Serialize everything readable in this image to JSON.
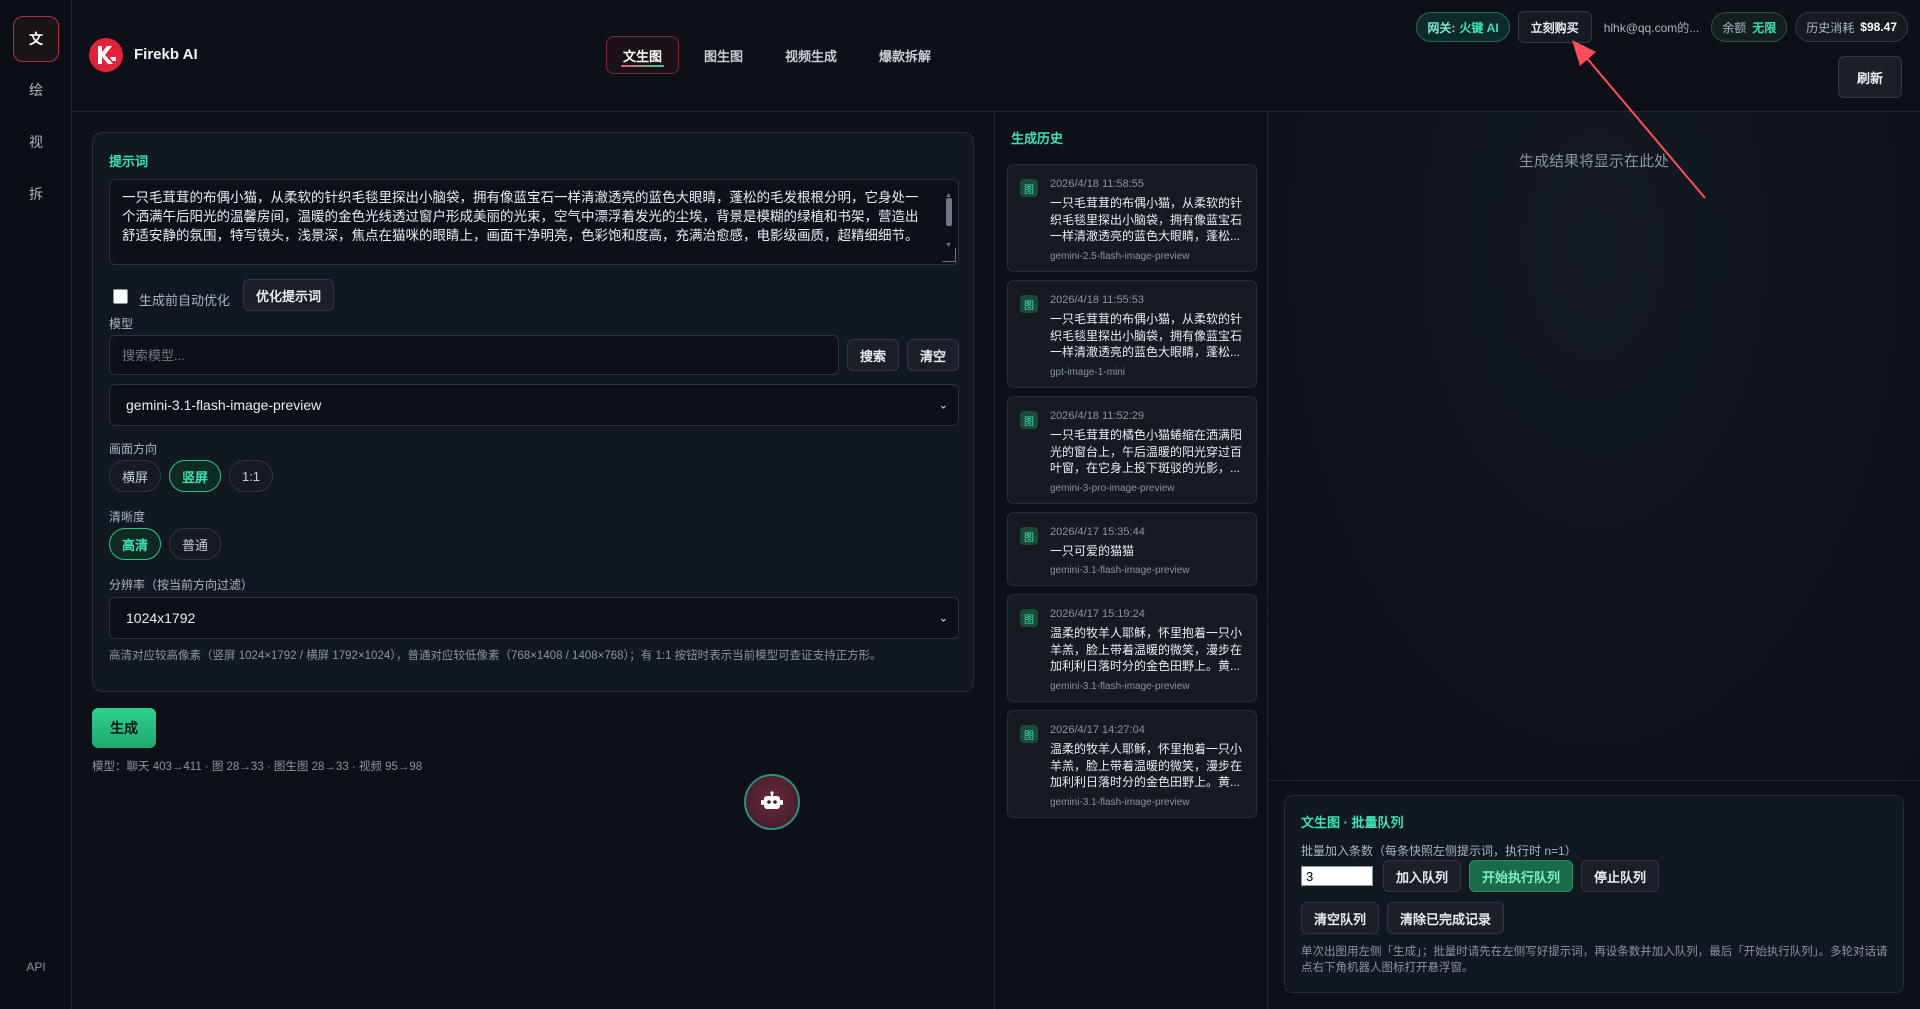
{
  "rail": {
    "items": [
      {
        "label": "文",
        "active": true
      },
      {
        "label": "绘",
        "active": false
      },
      {
        "label": "视",
        "active": false
      },
      {
        "label": "拆",
        "active": false
      }
    ],
    "api": "API"
  },
  "header": {
    "brand": "Firekb AI",
    "tabs": [
      {
        "label": "文生图",
        "active": true
      },
      {
        "label": "图生图",
        "active": false
      },
      {
        "label": "视频生成",
        "active": false
      },
      {
        "label": "爆款拆解",
        "active": false
      }
    ],
    "gateway_label": "网关:",
    "gateway_value": "火键 AI",
    "buy_label": "立刻购买",
    "email": "hlhk@qq.com的...",
    "balance_label": "余额",
    "balance_value": "无限",
    "history_label": "历史消耗",
    "history_value": "$98.47",
    "refresh_label": "刷新"
  },
  "prompt": {
    "section_label": "提示词",
    "text": "一只毛茸茸的布偶小猫，从柔软的针织毛毯里探出小脑袋，拥有像蓝宝石一样清澈透亮的蓝色大眼睛，蓬松的毛发根根分明，它身处一个洒满午后阳光的温馨房间，温暖的金色光线透过窗户形成美丽的光束，空气中漂浮着发光的尘埃，背景是模糊的绿植和书架，营造出舒适安静的氛围，特写镜头，浅景深，焦点在猫咪的眼睛上，画面干净明亮，色彩饱和度高，充满治愈感，电影级画质，超精细细节。",
    "auto_optimize_label": "生成前自动优化",
    "optimize_button": "优化提示词"
  },
  "model": {
    "label": "模型",
    "search_placeholder": "搜索模型...",
    "search_button": "搜索",
    "clear_button": "清空",
    "selected": "gemini-3.1-flash-image-preview"
  },
  "orientation": {
    "label": "画面方向",
    "options": [
      {
        "label": "横屏",
        "active": false
      },
      {
        "label": "竖屏",
        "active": true
      },
      {
        "label": "1:1",
        "active": false
      }
    ]
  },
  "quality": {
    "label": "清晰度",
    "options": [
      {
        "label": "高清",
        "active": true
      },
      {
        "label": "普通",
        "active": false
      }
    ]
  },
  "resolution": {
    "label": "分辨率（按当前方向过滤）",
    "selected": "1024x1792",
    "hint": "高清对应较高像素（竖屏 1024×1792 / 横屏 1792×1024），普通对应较低像素（768×1408 / 1408×768）；有 1:1 按钮时表示当前模型可查证支持正方形。"
  },
  "generate_label": "生成",
  "model_stats": "模型：聊天 403→411 · 图 28→33 · 图生图 28→33 · 视频 95→98",
  "history": {
    "title": "生成历史",
    "items": [
      {
        "badge": "图",
        "time": "2026/4/18 11:58:55",
        "text": "一只毛茸茸的布偶小猫，从柔软的针织毛毯里探出小脑袋，拥有像蓝宝石一样清澈透亮的蓝色大眼睛，蓬松...",
        "model": "gemini-2.5-flash-image-preview"
      },
      {
        "badge": "图",
        "time": "2026/4/18 11:55:53",
        "text": "一只毛茸茸的布偶小猫，从柔软的针织毛毯里探出小脑袋，拥有像蓝宝石一样清澈透亮的蓝色大眼睛，蓬松...",
        "model": "gpt-image-1-mini"
      },
      {
        "badge": "图",
        "time": "2026/4/18 11:52:29",
        "text": "一只毛茸茸的橘色小猫蜷缩在洒满阳光的窗台上，午后温暖的阳光穿过百叶窗，在它身上投下斑驳的光影，...",
        "model": "gemini-3-pro-image-preview"
      },
      {
        "badge": "图",
        "time": "2026/4/17 15:35:44",
        "text": "一只可爱的猫猫",
        "model": "gemini-3.1-flash-image-preview"
      },
      {
        "badge": "图",
        "time": "2026/4/17 15:19:24",
        "text": "温柔的牧羊人耶稣，怀里抱着一只小羊羔，脸上带着温暖的微笑，漫步在加利利日落时分的金色田野上。黄...",
        "model": "gemini-3.1-flash-image-preview"
      },
      {
        "badge": "图",
        "time": "2026/4/17 14:27:04",
        "text": "温柔的牧羊人耶稣，怀里抱着一只小羊羔，脸上带着温暖的微笑，漫步在加利利日落时分的金色田野上。黄...",
        "model": "gemini-3.1-flash-image-preview"
      }
    ]
  },
  "result": {
    "placeholder": "生成结果将显示在此处"
  },
  "queue": {
    "title": "文生图 · 批量队列",
    "count_label": "批量加入条数（每条快照左侧提示词，执行时 n=1）",
    "count_value": "3",
    "add_button": "加入队列",
    "start_button": "开始执行队列",
    "stop_button": "停止队列",
    "clear_button": "清空队列",
    "clear_done_button": "清除已完成记录",
    "note": "单次出图用左侧「生成」；批量时请先在左侧写好提示词，再设条数并加入队列，最后「开始执行队列」。多轮对话请点右下角机器人图标打开悬浮窗。"
  },
  "colors": {
    "accent_green": "#3ee0b5",
    "accent_red": "#ff4d6d",
    "arrow": "#ff4d5a"
  }
}
